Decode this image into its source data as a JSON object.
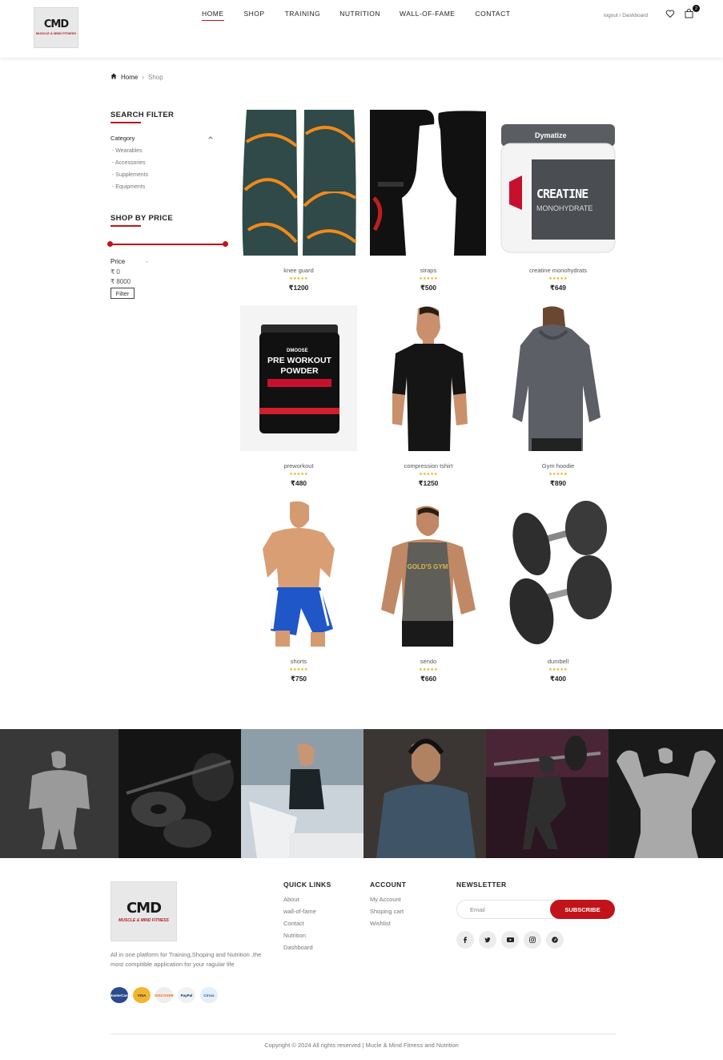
{
  "header": {
    "logo": {
      "mark": "CMD",
      "subtitle": "MUSCLE & MIND FITNESS"
    },
    "nav": [
      "HOME",
      "SHOP",
      "TRAINING",
      "NUTRITION",
      "WALL-OF-FAME",
      "CONTACT"
    ],
    "active_nav": "HOME",
    "account_link": "logout / Dashboard",
    "cart_count": "2",
    "icons": [
      "heart-icon",
      "bag-icon"
    ]
  },
  "breadcrumb": {
    "home": "Home",
    "separator": "›",
    "current": "Shop"
  },
  "sidebar": {
    "search_filter_title": "SEARCH FILTER",
    "category_label": "Category",
    "categories": [
      "Wearables",
      "Accessories",
      "Supplements",
      "Equipments"
    ],
    "shop_by_price_title": "SHOP BY PRICE",
    "price_label": "Price",
    "price_dash": "-",
    "price_min": "₹ 0",
    "price_max": "₹ 8000",
    "filter_button": "Filter"
  },
  "products": [
    {
      "name": "knee guard",
      "rating": "★★★★★",
      "price": "₹1200"
    },
    {
      "name": "straps",
      "rating": "★★★★★",
      "price": "₹500"
    },
    {
      "name": "creatine monohydrats",
      "rating": "★★★★★",
      "price": "₹649"
    },
    {
      "name": "preworkout",
      "rating": "★★★★★",
      "price": "₹480"
    },
    {
      "name": "compression tshirt",
      "rating": "★★★★★",
      "price": "₹1250"
    },
    {
      "name": "Gym hoodie",
      "rating": "★★★★★",
      "price": "₹890"
    },
    {
      "name": "shorts",
      "rating": "★★★★★",
      "price": "₹750"
    },
    {
      "name": "sendo",
      "rating": "★★★★★",
      "price": "₹660"
    },
    {
      "name": "dumbell",
      "rating": "★★★★★",
      "price": "₹400"
    }
  ],
  "product_art": {
    "creatine_brand": "Dymatize",
    "creatine_title": "CREATINE",
    "creatine_sub": "MONOHYDRATE",
    "preworkout_brand": "DMOOSE",
    "preworkout_title_1": "PRE WORKOUT",
    "preworkout_title_2": "POWDER",
    "tank_print": "GOLD'S GYM"
  },
  "footer": {
    "logo": {
      "mark": "CMD",
      "subtitle": "MUSCLE & MIND FITNESS"
    },
    "description": "All in one platform for Training,Shoping and Nutrition ,the most compitible application for your ragular life",
    "payments": [
      "MasterCard",
      "VISA",
      "DISCOVER",
      "PayPal",
      "Cirrus"
    ],
    "quick_links_title": "QUICK LINKS",
    "quick_links": [
      "About",
      "wall-of-fame",
      "Contact",
      "Nutrition",
      "Dashboard"
    ],
    "account_title": "ACCOUNT",
    "account_links": [
      "My Account",
      "Shoping cart",
      "Wishlist"
    ],
    "newsletter_title": "NEWSLETTER",
    "email_placeholder": "Email",
    "subscribe_button": "SUBSCRIBE",
    "social": [
      "facebook-icon",
      "twitter-icon",
      "youtube-icon",
      "instagram-icon",
      "pinterest-icon"
    ],
    "copyright": "Copyright © 2024 All rights reserved | Mucle & Mind Fitness and Nutrition"
  },
  "colors": {
    "accent": "#c0141a",
    "stars": "#e6a700",
    "text": "#222222",
    "muted": "#777777"
  }
}
